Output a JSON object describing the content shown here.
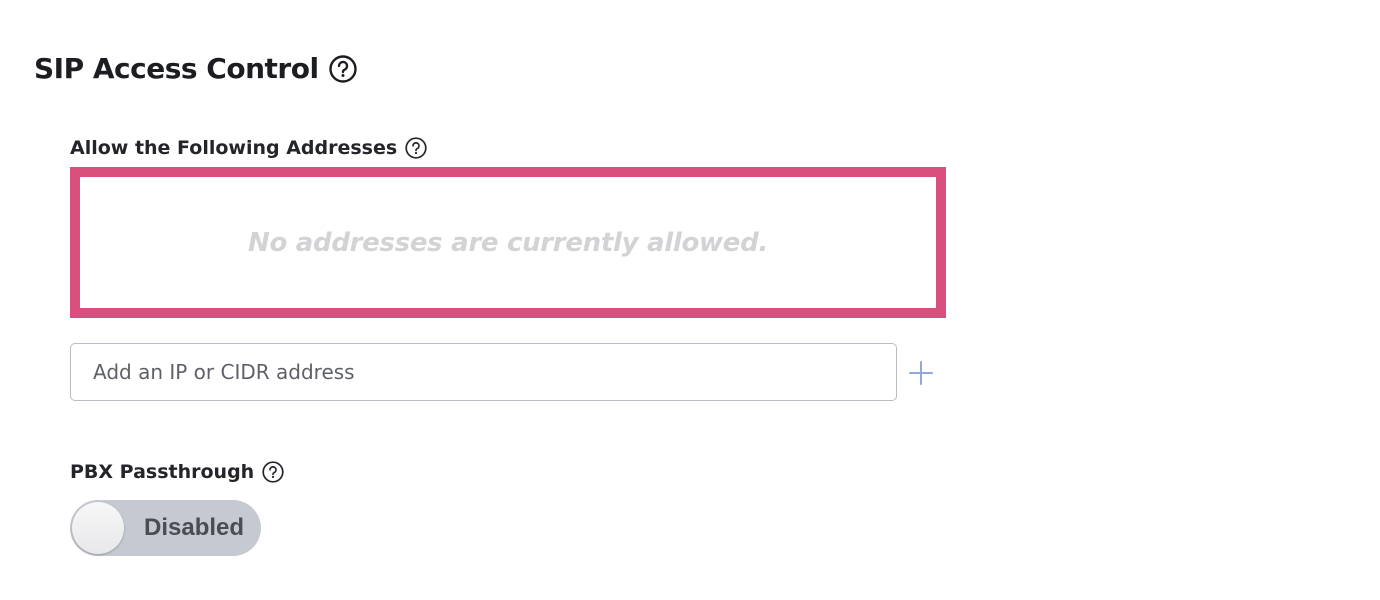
{
  "section": {
    "title": "SIP Access Control"
  },
  "allow_list": {
    "label": "Allow the Following Addresses",
    "empty_message": "No addresses are currently allowed.",
    "border_color": "#d9507e",
    "input": {
      "value": "",
      "placeholder": "Add an IP or CIDR address"
    },
    "add_icon": "plus-icon"
  },
  "pbx_passthrough": {
    "label": "PBX Passthrough",
    "toggle_state": "Disabled",
    "enabled": false
  },
  "icons": {
    "help": "help-circle-icon",
    "add": "plus-icon"
  }
}
